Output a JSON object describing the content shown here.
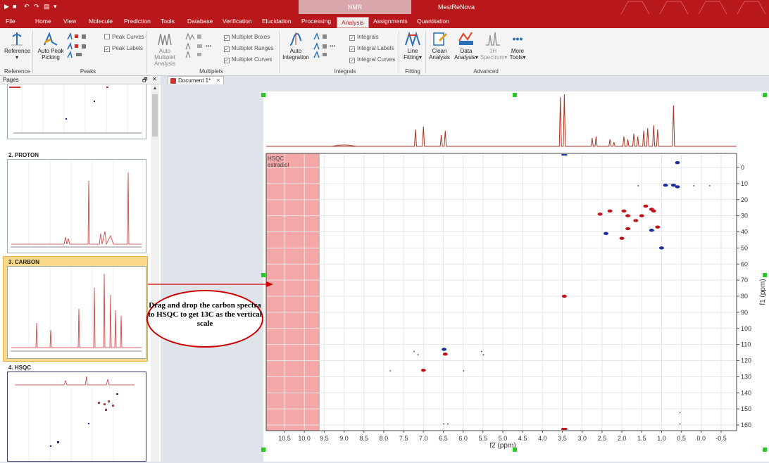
{
  "quick_access": [
    "▶",
    "■",
    "↶",
    "↷",
    "▤",
    "▾"
  ],
  "context_header": "NMR",
  "app_title": "MestReNova",
  "menu": [
    "File",
    "Home",
    "View",
    "Molecule",
    "Prediction",
    "Tools",
    "Database",
    "Verification",
    "Elucidation",
    "Processing",
    "Analysis",
    "Assignments",
    "Quantitation"
  ],
  "ribbon": {
    "reference": {
      "label": "Reference",
      "sub": "▾"
    },
    "auto_peak": {
      "label": "Auto Peak Picking"
    },
    "peak_curves": "Peak Curves",
    "peak_labels": "Peak Labels",
    "peaks_group": "Peaks",
    "reference_group": "Reference",
    "auto_multiplet": {
      "label": "Auto Multiplet Analysis"
    },
    "multiplet_boxes": "Multiplet Boxes",
    "multiplet_ranges": "Multiplet Ranges",
    "multiplet_curves": "Multiplet Curves",
    "multiplets_group": "Multiplets",
    "auto_integration": {
      "label": "Auto Integration"
    },
    "integrals": "Integrals",
    "integral_labels": "Integral Labels",
    "integral_curves": "Integral Curves",
    "integrals_group": "Integrals",
    "line_fitting": {
      "label": "Line Fitting▾"
    },
    "fitting_group": "Fitting",
    "clean_analysis": {
      "label": "Clean Analysis"
    },
    "data_analysis": {
      "label": "Data Analysis▾"
    },
    "spectrum_1h": {
      "label": "1H Spectrum▾"
    },
    "more_tools": {
      "label": "More Tools▾"
    },
    "advanced_group": "Advanced",
    "more_icon": "•••"
  },
  "pages_panel": {
    "title": "Pages",
    "pin": "🗗",
    "close": "✕",
    "thumbs": [
      {
        "label": "2. PROTON"
      },
      {
        "label": "3. CARBON"
      },
      {
        "label": "4. HSQC"
      }
    ]
  },
  "doc_tab": {
    "label": "Document 1*",
    "close": "✕"
  },
  "plot": {
    "title_line1": "HSQC",
    "title_line2": "estradiol",
    "xlabel": "f2 (ppm)",
    "ylabel": "f1 (ppm)",
    "xticks": [
      "10.5",
      "10.0",
      "9.5",
      "9.0",
      "8.5",
      "8.0",
      "7.5",
      "7.0",
      "6.5",
      "6.0",
      "5.5",
      "5.0",
      "4.5",
      "4.0",
      "3.5",
      "3.0",
      "2.5",
      "2.0",
      "1.5",
      "1.0",
      "0.5",
      "0.0",
      "-0.5"
    ],
    "yticks": [
      "0",
      "10",
      "20",
      "30",
      "40",
      "50",
      "60",
      "70",
      "80",
      "90",
      "100",
      "110",
      "120",
      "130",
      "140",
      "150",
      "160"
    ]
  },
  "callout": {
    "text": "Drag and drop  the carbon spectra to HSQC to get 13C as the vertical scale"
  },
  "colors": {
    "accent": "#b8171c",
    "peak_red": "#c0141c",
    "peak_blue": "#1a2f9c",
    "highlight": "#f3a7a7"
  }
}
